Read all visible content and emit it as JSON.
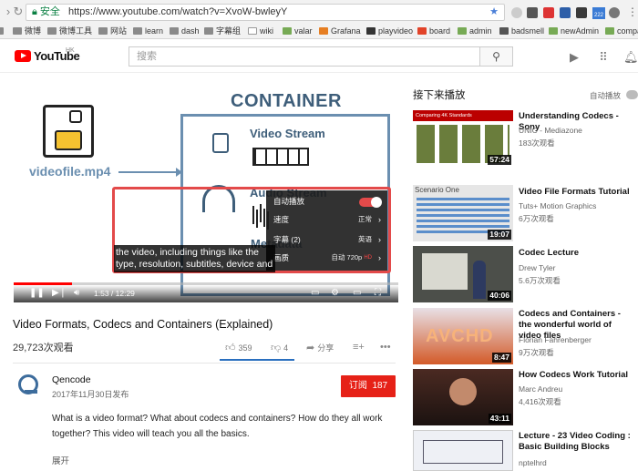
{
  "browser": {
    "secure_label": "安全",
    "url": "https://www.youtube.com/watch?v=XvoW-bwleyY",
    "badge": "222",
    "bookmarks": [
      "微博",
      "微博工具",
      "网站",
      "learn",
      "dash",
      "字幕组",
      "wiki",
      "valar",
      "Grafana",
      "playvideo",
      "board",
      "admin",
      "badsmell",
      "newAdmin",
      "compa"
    ]
  },
  "header": {
    "logo_text": "YouTube",
    "logo_region": "HK",
    "search_placeholder": "搜索"
  },
  "player": {
    "slide_title": "CONTAINER",
    "filename": "videofile.mp4",
    "video_stream_label": "Video Stream",
    "audio_stream_label": "Audio Stream",
    "metadata_label": "Metadata",
    "captions": [
      "the video, including things like the",
      "type, resolution, subtitles, device and"
    ],
    "settings_menu": {
      "autoplay": "自动播放",
      "speed": "速度",
      "speed_value": "正常",
      "subtitles": "字幕 (2)",
      "subtitles_value": "英语",
      "quality": "画质",
      "quality_value": "自动 720p",
      "quality_badge": "HD"
    },
    "time": "1:53 / 12:29",
    "progress_fraction": 0.151
  },
  "video": {
    "title": "Video Formats, Codecs and Containers (Explained)",
    "views": "29,723次观看",
    "likes": "359",
    "dislikes": "4",
    "share": "分享",
    "channel": "Qencode",
    "published": "2017年11月30日发布",
    "subscribe_label": "订阅",
    "subscriber_count": "187",
    "description": "What is a video format? What about codecs and containers? How do they all work together? This video will teach you all the basics.",
    "show_more": "展开"
  },
  "sidebar": {
    "up_next": "接下来播放",
    "autoplay": "自动播放",
    "items": [
      {
        "title": "Understanding Codecs - Sony",
        "channel": "UNIC - Mediazone",
        "views": "183次观看",
        "duration": "57:24"
      },
      {
        "title": "Video File Formats Tutorial",
        "channel": "Tuts+ Motion Graphics",
        "views": "6万次观看",
        "duration": "19:07"
      },
      {
        "title": "Codec Lecture",
        "channel": "Drew Tyler",
        "views": "5.6万次观看",
        "duration": "40:06"
      },
      {
        "title": "Codecs and Containers - the wonderful world of video files",
        "channel": "Florian Fahrenberger",
        "views": "9万次观看",
        "duration": "8:47"
      },
      {
        "title": "How Codecs Work Tutorial",
        "channel": "Marc Andreu",
        "views": "4,416次观看",
        "duration": "43:11"
      },
      {
        "title": "Lecture - 23 Video Coding : Basic Building Blocks",
        "channel": "nptelhrd",
        "views": "",
        "duration": ""
      }
    ],
    "thumb1_banner": "Comparing 4K Standards",
    "thumb2_label": "Scenario One",
    "thumb4_label": "AVCHD"
  }
}
